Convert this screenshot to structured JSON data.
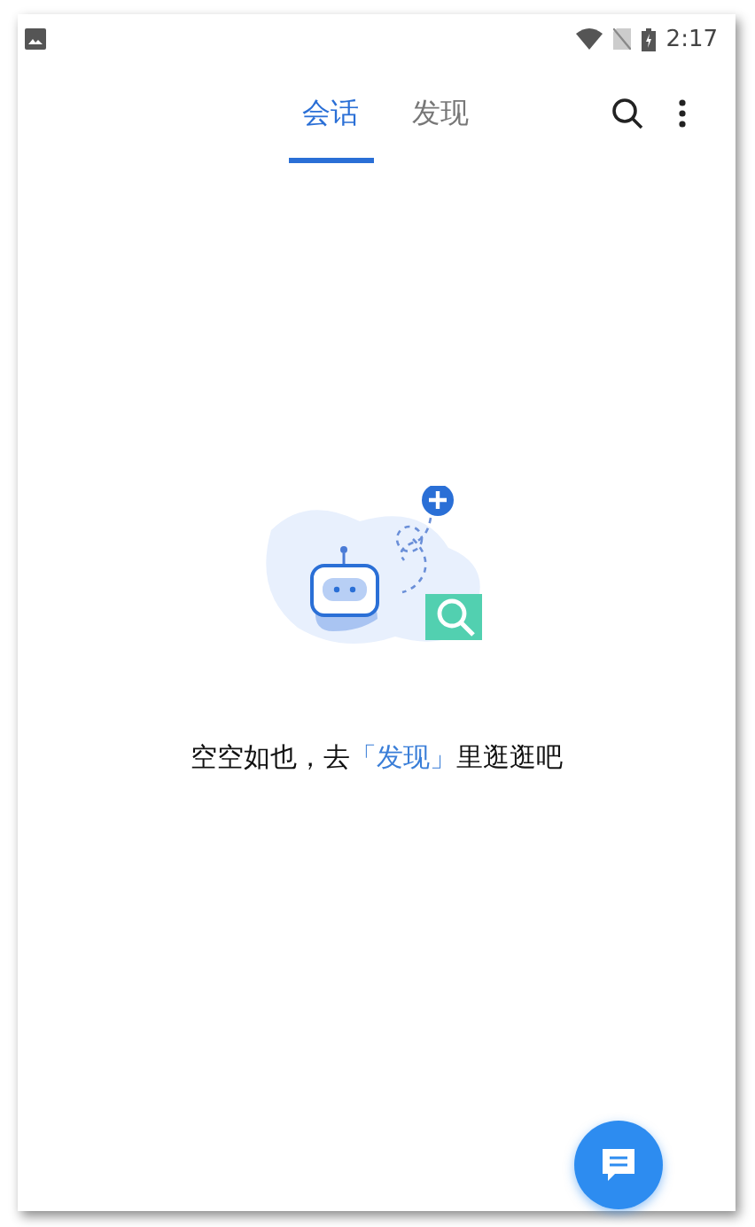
{
  "status_bar": {
    "time": "2:17"
  },
  "tabs": [
    {
      "label": "会话",
      "selected": true
    },
    {
      "label": "发现",
      "selected": false
    }
  ],
  "empty_state": {
    "text_before": "空空如也，去",
    "link": "「发现」",
    "text_after": "里逛逛吧"
  }
}
